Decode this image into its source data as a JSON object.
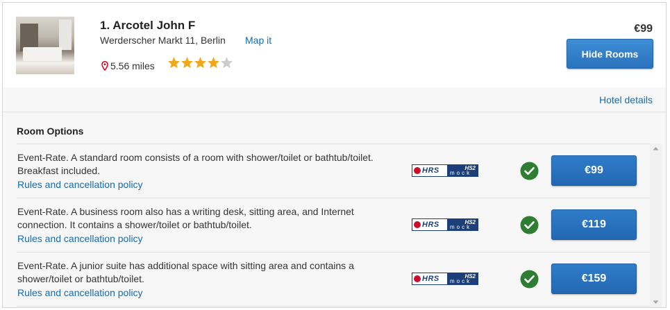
{
  "hotel": {
    "title": "1. Arcotel John F",
    "address": "Werderscher Markt 11, Berlin",
    "map_link": "Map it",
    "distance": "5.56 miles",
    "rating": 4,
    "rating_max": 5,
    "price": "€99",
    "hide_button": "Hide Rooms",
    "details_link": "Hotel details"
  },
  "rooms": {
    "title": "Room Options",
    "items": [
      {
        "description": "Event-Rate. A standard room consists of a room with shower/toilet or bathtub/toilet. Breakfast included.",
        "policy": "Rules and cancellation policy",
        "price": "€99"
      },
      {
        "description": "Event-Rate. A business room also has a writing desk, sitting area, and Internet connection. It contains a shower/toilet or bathtub/toilet.",
        "policy": "Rules and cancellation policy",
        "price": "€119"
      },
      {
        "description": "Event-Rate. A junior suite has additional space with sitting area and contains a shower/toilet or bathtub/toilet.",
        "policy": "Rules and cancellation policy",
        "price": "€159"
      }
    ]
  },
  "provider": {
    "left": "HRS",
    "right_top": "HS2",
    "right_bottom": "mock"
  },
  "colors": {
    "link": "#1a6aa9",
    "button": "#2a72bd",
    "check": "#2e7d32",
    "star": "#f0a818",
    "star_empty": "#cccccc",
    "pin": "#d0021b"
  },
  "icons": {
    "pin": "location-pin-icon",
    "star": "star-icon",
    "check": "check-circle-icon"
  }
}
